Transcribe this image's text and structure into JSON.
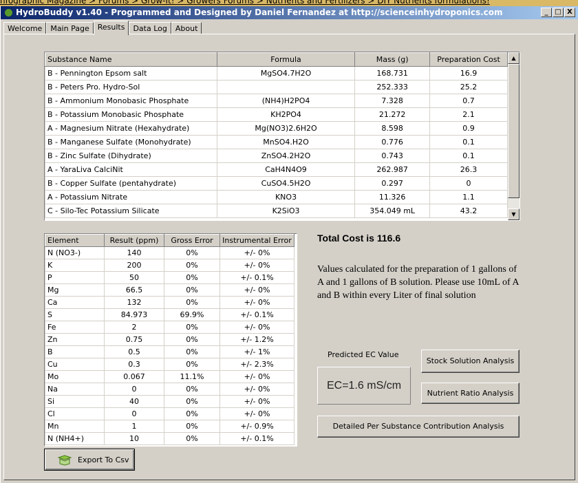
{
  "browser_breadcrumb": "nfographic Magazine > Forums > Grow-It! > Growers Forums > Nutrients and Fertilizers > DIY Nutrients formulations!",
  "window": {
    "title": "HydroBuddy v1.40 - Programmed and Designed by Daniel Fernandez at http://scienceinhydroponics.com",
    "minimize": "_",
    "maximize": "□",
    "close": "X"
  },
  "tabs": [
    {
      "label": "Welcome"
    },
    {
      "label": "Main Page"
    },
    {
      "label": "Results",
      "active": true
    },
    {
      "label": "Data Log"
    },
    {
      "label": "About"
    }
  ],
  "substances": {
    "headers": [
      "Substance Name",
      "Formula",
      "Mass (g)",
      "Preparation Cost"
    ],
    "rows": [
      [
        "B - Pennington Epsom salt",
        "MgSO4.7H2O",
        "168.731",
        "16.9"
      ],
      [
        "B - Peters Pro. Hydro-Sol",
        "",
        "252.333",
        "25.2"
      ],
      [
        "B - Ammonium Monobasic Phosphate",
        "(NH4)H2PO4",
        "7.328",
        "0.7"
      ],
      [
        "B - Potassium Monobasic Phosphate",
        "KH2PO4",
        "21.272",
        "2.1"
      ],
      [
        "A - Magnesium Nitrate (Hexahydrate)",
        "Mg(NO3)2.6H2O",
        "8.598",
        "0.9"
      ],
      [
        "B - Manganese Sulfate (Monohydrate)",
        "MnSO4.H2O",
        "0.776",
        "0.1"
      ],
      [
        "B - Zinc Sulfate (Dihydrate)",
        "ZnSO4.2H2O",
        "0.743",
        "0.1"
      ],
      [
        "A - YaraLiva CalciNit",
        "CaH4N4O9",
        "262.987",
        "26.3"
      ],
      [
        "B - Copper Sulfate (pentahydrate)",
        "CuSO4.5H2O",
        "0.297",
        "0"
      ],
      [
        "A - Potassium Nitrate",
        "KNO3",
        "11.326",
        "1.1"
      ],
      [
        "C - Silo-Tec Potassium Silicate",
        "K2SiO3",
        "354.049 mL",
        "43.2"
      ]
    ]
  },
  "elements": {
    "headers": [
      "Element",
      "Result (ppm)",
      "Gross Error",
      "Instrumental Error"
    ],
    "rows": [
      [
        "N (NO3-)",
        "140",
        "0%",
        "+/- 0%"
      ],
      [
        "K",
        "200",
        "0%",
        "+/- 0%"
      ],
      [
        "P",
        "50",
        "0%",
        "+/- 0.1%"
      ],
      [
        "Mg",
        "66.5",
        "0%",
        "+/- 0%"
      ],
      [
        "Ca",
        "132",
        "0%",
        "+/- 0%"
      ],
      [
        "S",
        "84.973",
        "69.9%",
        "+/- 0.1%"
      ],
      [
        "Fe",
        "2",
        "0%",
        "+/- 0%"
      ],
      [
        "Zn",
        "0.75",
        "0%",
        "+/- 1.2%"
      ],
      [
        "B",
        "0.5",
        "0%",
        "+/- 1%"
      ],
      [
        "Cu",
        "0.3",
        "0%",
        "+/- 2.3%"
      ],
      [
        "Mo",
        "0.067",
        "11.1%",
        "+/- 0%"
      ],
      [
        "Na",
        "0",
        "0%",
        "+/- 0%"
      ],
      [
        "Si",
        "40",
        "0%",
        "+/- 0%"
      ],
      [
        "Cl",
        "0",
        "0%",
        "+/- 0%"
      ],
      [
        "Mn",
        "1",
        "0%",
        "+/- 0.9%"
      ],
      [
        "N (NH4+)",
        "10",
        "0%",
        "+/- 0.1%"
      ]
    ]
  },
  "summary": {
    "total_cost": "Total Cost is 116.6",
    "note": "Values calculated for the preparation of 1 gallons of A and 1 gallons of B solution. Please use 10mL of A and B within every Liter of final solution",
    "ec_label": "Predicted EC Value",
    "ec_value": "EC=1.6 mS/cm"
  },
  "buttons": {
    "stock": "Stock Solution Analysis",
    "ratio": "Nutrient Ratio Analysis",
    "detailed": "Detailed Per Substance Contribution Analysis",
    "export": "Export To Csv"
  },
  "icons": {
    "app": "hydrobuddy-leaf-icon",
    "export": "box-icon",
    "scroll_up": "▲",
    "scroll_down": "▼"
  },
  "colors": {
    "titlebar_start": "#0a246a",
    "titlebar_end": "#a6caf0",
    "face": "#d4d0c8"
  }
}
